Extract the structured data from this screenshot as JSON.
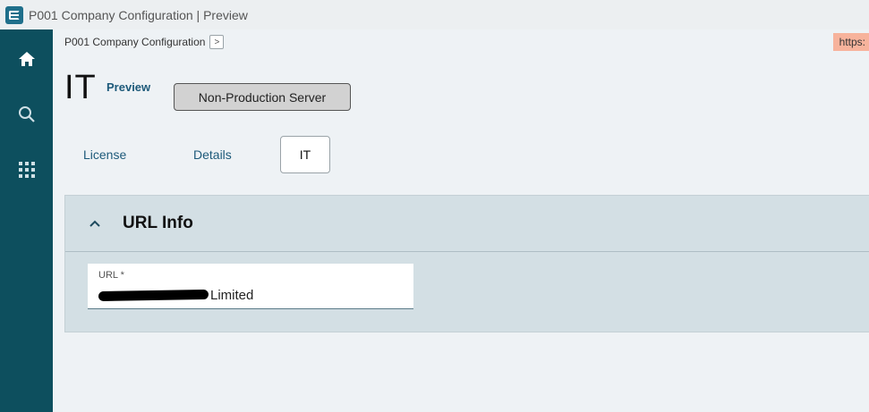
{
  "window": {
    "title": "P001 Company Configuration | Preview"
  },
  "nav": {
    "items": [
      {
        "name": "home",
        "icon": "home-icon"
      },
      {
        "name": "search",
        "icon": "search-icon"
      },
      {
        "name": "apps",
        "icon": "grid-icon"
      }
    ],
    "color": "#0d4f5e"
  },
  "breadcrumb": {
    "label": "P001 Company Configuration",
    "chevron": ">"
  },
  "url_badge": {
    "text": "https:",
    "color": "#f7b39c"
  },
  "header": {
    "title": "IT",
    "preview_label": "Preview",
    "server_badge": "Non-Production Server"
  },
  "tabs": [
    {
      "label": "License",
      "active": false
    },
    {
      "label": "Details",
      "active": false
    },
    {
      "label": "IT",
      "active": true
    }
  ],
  "section": {
    "title": "URL Info",
    "expanded": true,
    "fields": [
      {
        "label": "URL *",
        "value_visible_suffix": "Limited",
        "redacted": true
      }
    ]
  }
}
